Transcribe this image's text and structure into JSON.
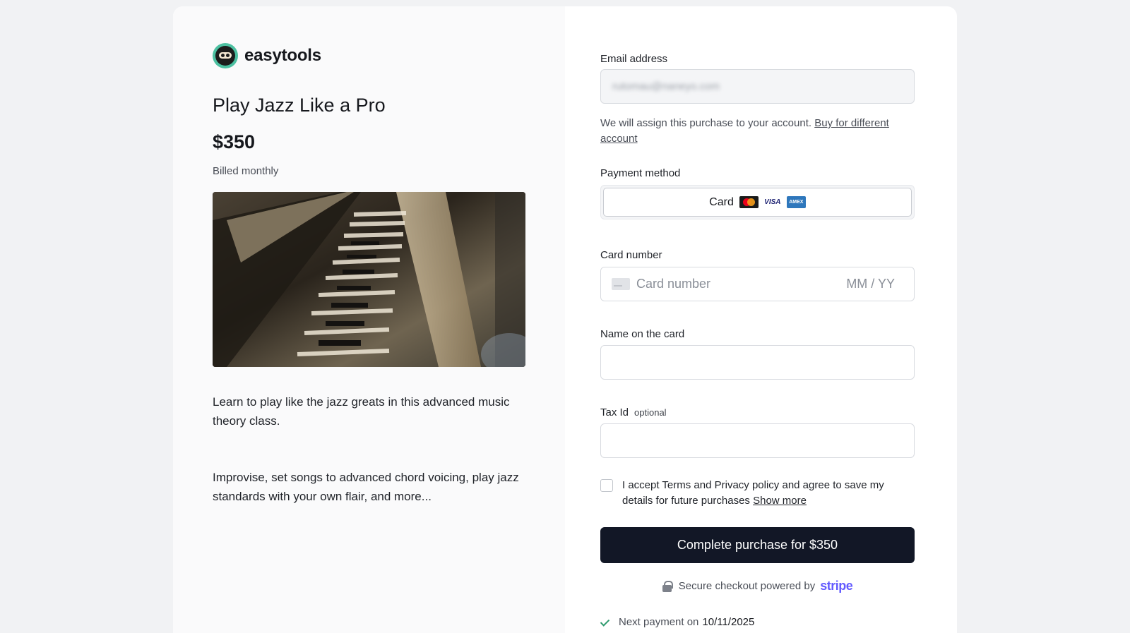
{
  "brand": {
    "name": "easytools"
  },
  "product": {
    "title": "Play Jazz Like a Pro",
    "price": "$350",
    "billing": "Billed monthly",
    "description_1": "Learn to play like the jazz greats in this advanced music theory class.",
    "description_2": "Improvise, set songs to advanced chord voicing, play jazz standards with your own flair, and more..."
  },
  "form": {
    "email_label": "Email address",
    "email_value": "rutomau@naneyo.com",
    "assign_note": "We will assign this purchase to your account.",
    "assign_link": "Buy for different account",
    "payment_method_label": "Payment method",
    "payment_tab_label": "Card",
    "card_brands": [
      "mastercard",
      "VISA",
      "AMEX"
    ],
    "card_number_label": "Card number",
    "card_number_placeholder": "Card number",
    "expiry_placeholder": "MM / YY",
    "name_label": "Name on the card",
    "tax_label": "Tax Id",
    "tax_optional": "optional",
    "consent_text": "I accept Terms and Privacy policy and agree to save my details for future purchases",
    "consent_link": "Show more",
    "submit_label": "Complete purchase for $350",
    "secure_text": "Secure checkout powered by",
    "secure_brand": "stripe",
    "next_payment_label": "Next payment on",
    "next_payment_date": "10/11/2025"
  },
  "colors": {
    "button_bg": "#121726",
    "stripe": "#635bff",
    "logo": "#4cc0a1"
  }
}
